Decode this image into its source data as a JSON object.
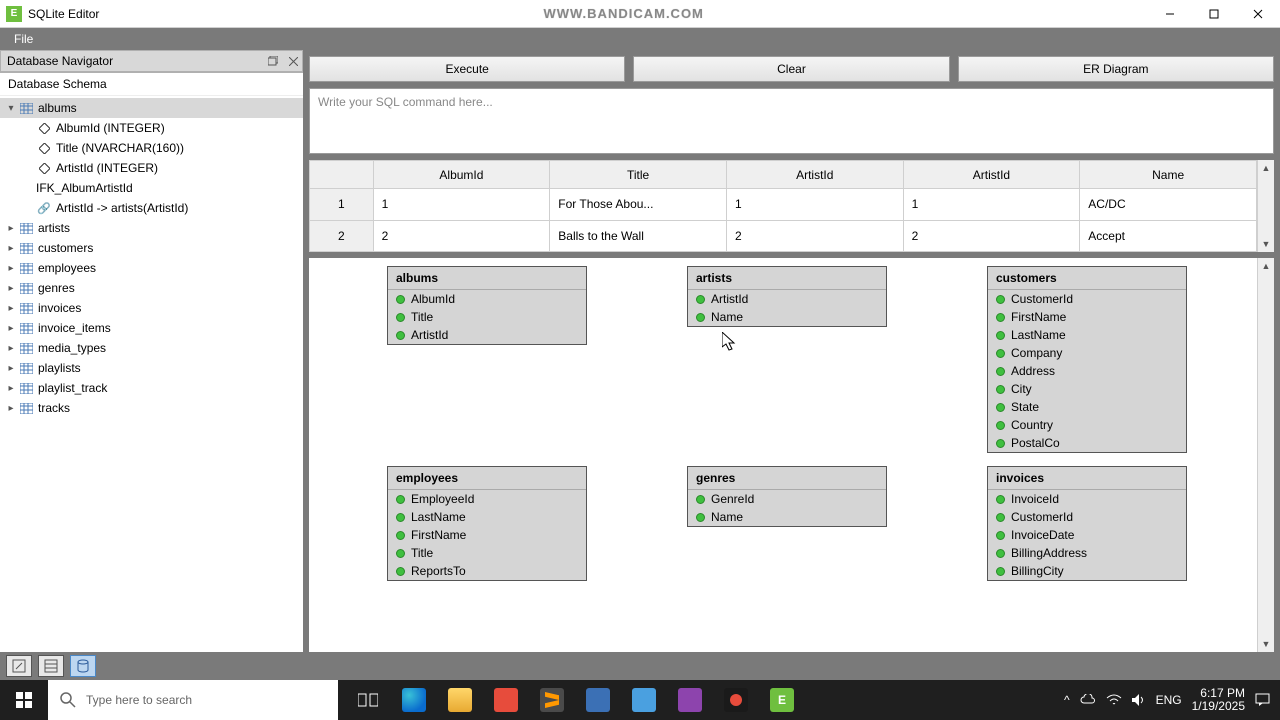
{
  "window": {
    "title": "SQLite Editor",
    "watermark": "WWW.BANDICAM.COM"
  },
  "menu": {
    "file": "File"
  },
  "navigator": {
    "panel_title": "Database Navigator",
    "schema_label": "Database Schema",
    "albums": {
      "name": "albums",
      "cols": [
        "AlbumId (INTEGER)",
        "Title (NVARCHAR(160))",
        "ArtistId (INTEGER)"
      ],
      "fk_header": "IFK_AlbumArtistId",
      "fk_detail": "ArtistId -> artists(ArtistId)"
    },
    "tables": [
      "artists",
      "customers",
      "employees",
      "genres",
      "invoices",
      "invoice_items",
      "media_types",
      "playlists",
      "playlist_track",
      "tracks"
    ]
  },
  "buttons": {
    "execute": "Execute",
    "clear": "Clear",
    "erdiagram": "ER Diagram"
  },
  "sql": {
    "placeholder": "Write your SQL command here..."
  },
  "grid": {
    "headers": [
      "AlbumId",
      "Title",
      "ArtistId",
      "ArtistId",
      "Name"
    ],
    "rows": [
      {
        "n": "1",
        "c": [
          "1",
          "For Those Abou...",
          "1",
          "1",
          "AC/DC"
        ]
      },
      {
        "n": "2",
        "c": [
          "2",
          "Balls to the Wall",
          "2",
          "2",
          "Accept"
        ]
      }
    ]
  },
  "er": {
    "albums": {
      "title": "albums",
      "cols": [
        "AlbumId",
        "Title",
        "ArtistId"
      ]
    },
    "artists": {
      "title": "artists",
      "cols": [
        "ArtistId",
        "Name"
      ]
    },
    "customers": {
      "title": "customers",
      "cols": [
        "CustomerId",
        "FirstName",
        "LastName",
        "Company",
        "Address",
        "City",
        "State",
        "Country",
        "PostalCo"
      ]
    },
    "employees": {
      "title": "employees",
      "cols": [
        "EmployeeId",
        "LastName",
        "FirstName",
        "Title",
        "ReportsTo"
      ]
    },
    "genres": {
      "title": "genres",
      "cols": [
        "GenreId",
        "Name"
      ]
    },
    "invoices": {
      "title": "invoices",
      "cols": [
        "InvoiceId",
        "CustomerId",
        "InvoiceDate",
        "BillingAddress",
        "BillingCity"
      ]
    }
  },
  "taskbar": {
    "search_placeholder": "Type here to search",
    "lang": "ENG",
    "time": "6:17 PM",
    "date": "1/19/2025"
  }
}
